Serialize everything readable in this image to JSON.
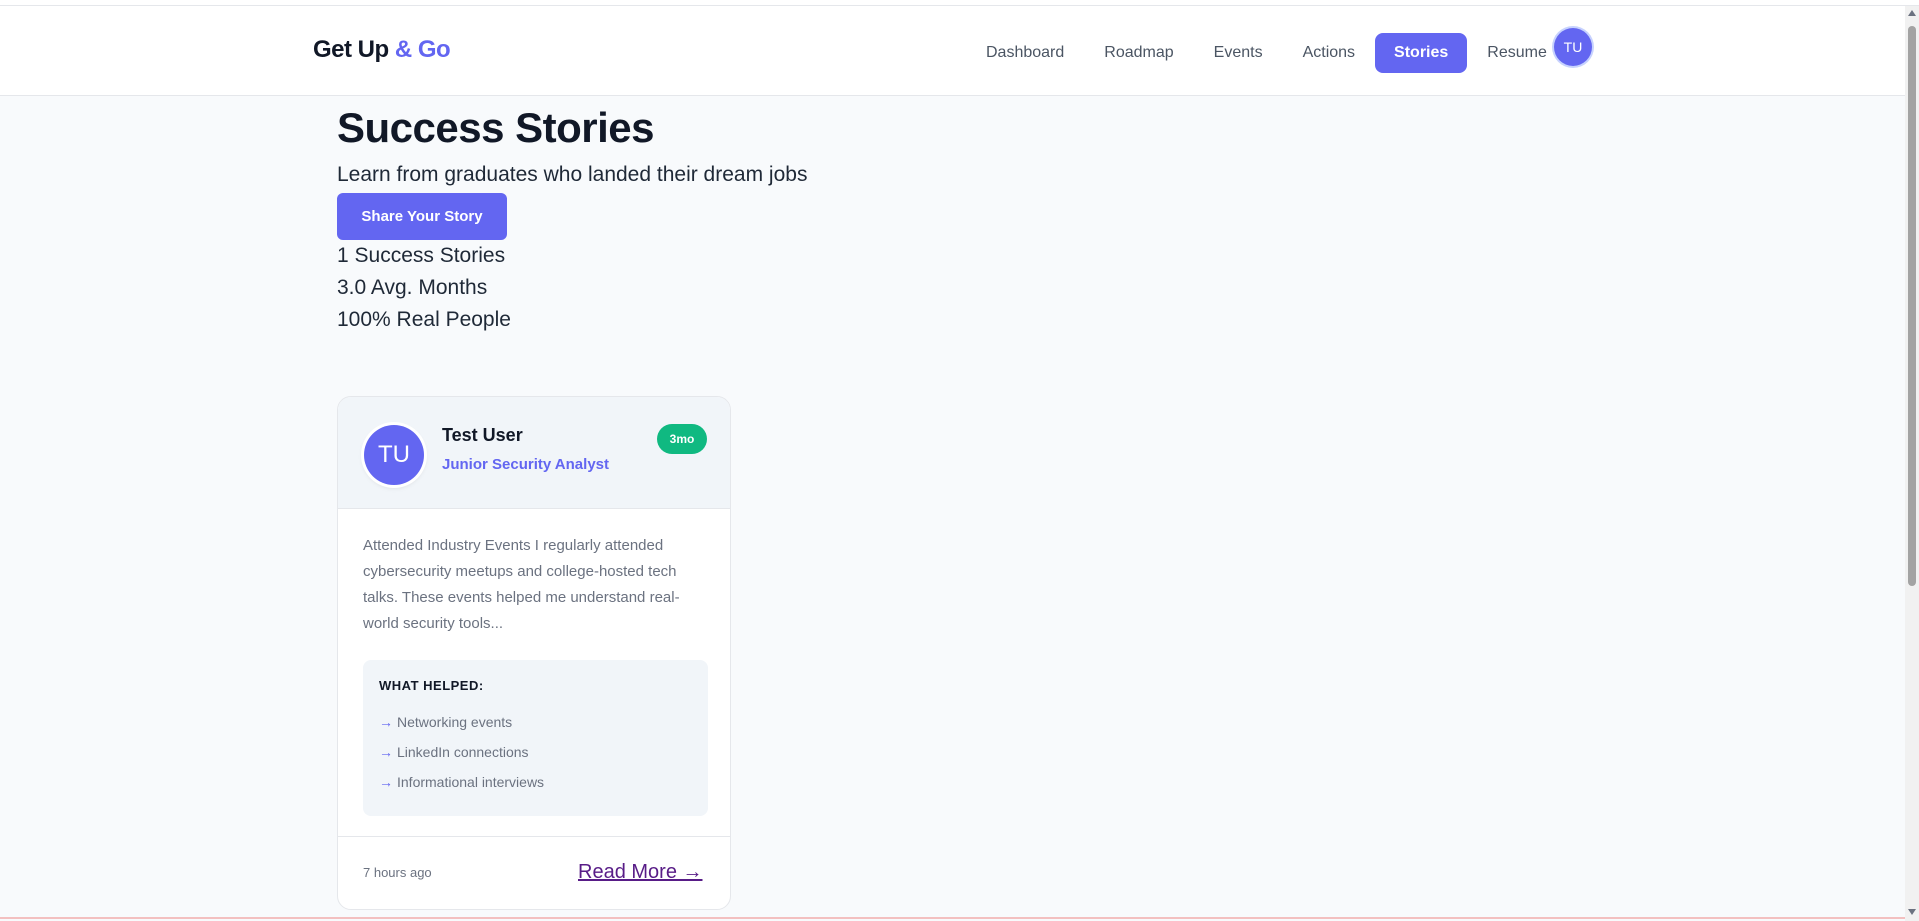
{
  "header": {
    "logo_main": "Get Up",
    "logo_accent": "& Go",
    "nav": [
      {
        "label": "Dashboard"
      },
      {
        "label": "Roadmap"
      },
      {
        "label": "Events"
      },
      {
        "label": "Actions"
      },
      {
        "label": "Stories"
      },
      {
        "label": "Resume"
      }
    ],
    "active_nav": "Stories",
    "avatar_initials": "TU"
  },
  "main": {
    "title": "Success Stories",
    "subtitle": "Learn from graduates who landed their dream jobs",
    "share_button": "Share Your Story",
    "stats": [
      {
        "text": "1 Success Stories"
      },
      {
        "text": "3.0 Avg. Months"
      },
      {
        "text": "100% Real People"
      }
    ]
  },
  "story": {
    "avatar_initials": "TU",
    "name": "Test User",
    "role": "Junior Security Analyst",
    "badge": "3mo",
    "text": "Attended Industry Events I regularly attended cybersecurity meetups and college-hosted tech talks. These events helped me understand real-world security tools...",
    "helped_title": "WHAT HELPED:",
    "helped_arrow": "→",
    "helped": [
      {
        "label": "Networking events"
      },
      {
        "label": "LinkedIn connections"
      },
      {
        "label": "Informational interviews"
      }
    ],
    "time": "7 hours ago",
    "read_more": "Read More →"
  },
  "colors": {
    "accent": "#6366f1",
    "badge_green": "#10b981",
    "background": "#f8fafc"
  }
}
